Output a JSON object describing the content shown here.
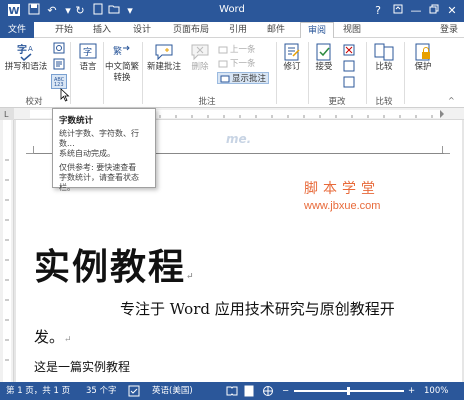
{
  "app": {
    "title": "Word",
    "login": "登录"
  },
  "quick_access": {
    "save_icon": "save-icon",
    "undo_icon": "undo-icon",
    "redo_icon": "redo-icon"
  },
  "tabs": [
    {
      "label": "文件"
    },
    {
      "label": "开始"
    },
    {
      "label": "插入"
    },
    {
      "label": "设计"
    },
    {
      "label": "页面布局"
    },
    {
      "label": "引用"
    },
    {
      "label": "邮件"
    },
    {
      "label": "审阅"
    },
    {
      "label": "视图"
    }
  ],
  "ribbon": {
    "proofing": {
      "spell_label": "拼写和语法",
      "group_label": "校对"
    },
    "language": {
      "label": "语言"
    },
    "convert": {
      "label1": "中文简繁",
      "label2": "转换"
    },
    "comments": {
      "new_label": "新建批注",
      "delete_label": "删除",
      "prev_label": "上一条",
      "next_label": "下一条",
      "show_label": "显示批注",
      "group_label": "批注"
    },
    "tracking": {
      "label": "修订"
    },
    "changes": {
      "accept_label": "接受",
      "group_label": "更改"
    },
    "compare": {
      "label": "比较",
      "group_label": "比较"
    },
    "protect": {
      "label": "保护"
    }
  },
  "tooltip": {
    "title": "字数统计",
    "line1": "统计字数、字符数、行",
    "line2": "数...",
    "line3": "系统自动完成。",
    "line4": "仅供参考: 要快速查看",
    "line5": "字数统计，请查看状态",
    "line6": "栏。"
  },
  "document": {
    "header_watermark": "me.",
    "brand_cn": "脚本学堂",
    "brand_url": "www.jbxue.com",
    "title": "实例教程",
    "para1": "专注于 Word 应用技术研究与原创教程开",
    "para2": "发。",
    "para3": "这是一篇实例教程"
  },
  "status": {
    "page": "第 1 页，共 1 页",
    "words": "35 个字",
    "language": "英语(美国)",
    "zoom": "100%"
  },
  "colors": {
    "accent": "#2b579a",
    "brand": "#e86a3a"
  }
}
